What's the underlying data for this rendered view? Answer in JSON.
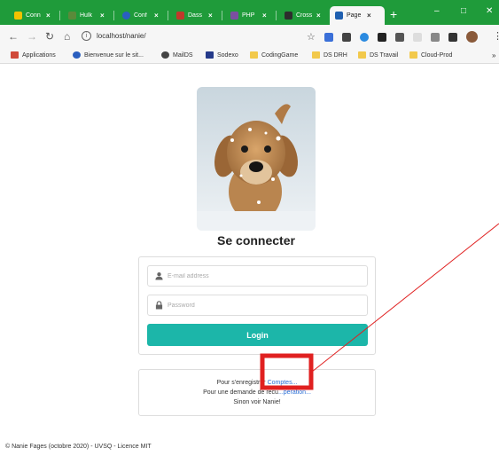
{
  "browser": {
    "tabs": [
      {
        "label": "Conn",
        "favicon_color": "#f2c200",
        "active": false
      },
      {
        "label": "Hulk",
        "favicon_color": "#5a8a3a",
        "active": false
      },
      {
        "label": "Conf",
        "favicon_color": "#2a5fbf",
        "active": false
      },
      {
        "label": "Dass",
        "favicon_color": "#c0392b",
        "active": false
      },
      {
        "label": "PHP",
        "favicon_color": "#7b4fa0",
        "active": false
      },
      {
        "label": "Cross",
        "favicon_color": "#2d2d2d",
        "active": false
      },
      {
        "label": "Page",
        "favicon_color": "#1f5fb0",
        "active": true
      }
    ],
    "new_tab": "+",
    "minimize": "–",
    "maximize": "□",
    "close": "✕",
    "url": "localhost/nanie/",
    "bookmarks": [
      {
        "label": "Applications",
        "icon": "apps-icon",
        "color": "#d04a3a"
      },
      {
        "label": "Bienvenue sur le sit...",
        "icon": "globe-icon",
        "color": "#2a5fbf"
      },
      {
        "label": "MailDS",
        "icon": "settings-icon",
        "color": "#444444"
      },
      {
        "label": "Sodexo",
        "icon": "sodexo-icon",
        "color": "#243a8a"
      },
      {
        "label": "CodingGame",
        "icon": "folder-icon",
        "color": "#f2c94c"
      },
      {
        "label": "DS DRH",
        "icon": "folder-icon",
        "color": "#f2c94c"
      },
      {
        "label": "DS Travail",
        "icon": "folder-icon",
        "color": "#f2c94c"
      },
      {
        "label": "Cloud-Prod",
        "icon": "folder-icon",
        "color": "#f2c94c"
      }
    ],
    "bookmarks_more": "»"
  },
  "page": {
    "title": "Se connecter",
    "email_placeholder": "E-mail address",
    "password_placeholder": "Password",
    "login_button": "Login",
    "register_prefix": "Pour s'enregistrer",
    "register_link": "Comptes...",
    "recovery_prefix": "Pour une demande de recu",
    "recovery_link": "...pération...",
    "otherwise": "Sinon voir Nanie!",
    "footer": "© Nanie Fages (octobre 2020) - UVSQ - Licence MIT",
    "accent_color": "#1cb6a9",
    "annotation_color": "#e02020"
  }
}
